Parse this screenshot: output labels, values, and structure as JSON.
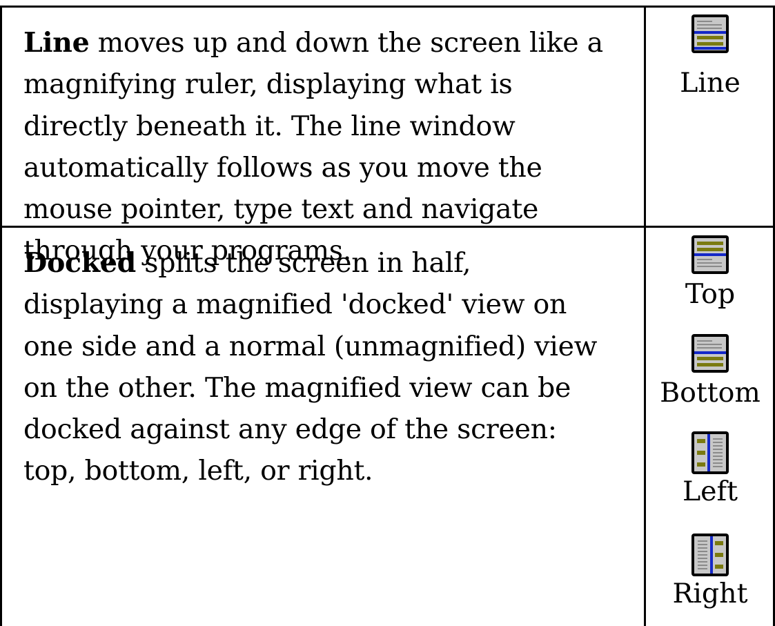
{
  "rows": [
    {
      "term": "Line",
      "description": " moves up and down the screen like a magnifying ruler, displaying what is directly beneath it. The line window automatically follows as you move the mouse pointer, type text and navigate through your programs.",
      "icons": [
        {
          "icon": "line-mode-icon",
          "caption": "Line"
        }
      ]
    },
    {
      "term": "Docked",
      "description": " splits the screen in half, displaying a magnified 'docked' view on one side and a normal (unmagnified) view on the other. The magnified view can be docked against any edge of the screen: top, bottom, left, or right.",
      "icons": [
        {
          "icon": "dock-top-icon",
          "caption": "Top"
        },
        {
          "icon": "dock-bottom-icon",
          "caption": "Bottom"
        },
        {
          "icon": "dock-left-icon",
          "caption": "Left"
        },
        {
          "icon": "dock-right-icon",
          "caption": "Right"
        }
      ]
    }
  ],
  "colors": {
    "icon_frame": "#000000",
    "icon_inner": "#c8c8c8",
    "magnified_band": "#7a7a10",
    "divider": "#1428c8",
    "text_lines": "#8a8a8a"
  }
}
